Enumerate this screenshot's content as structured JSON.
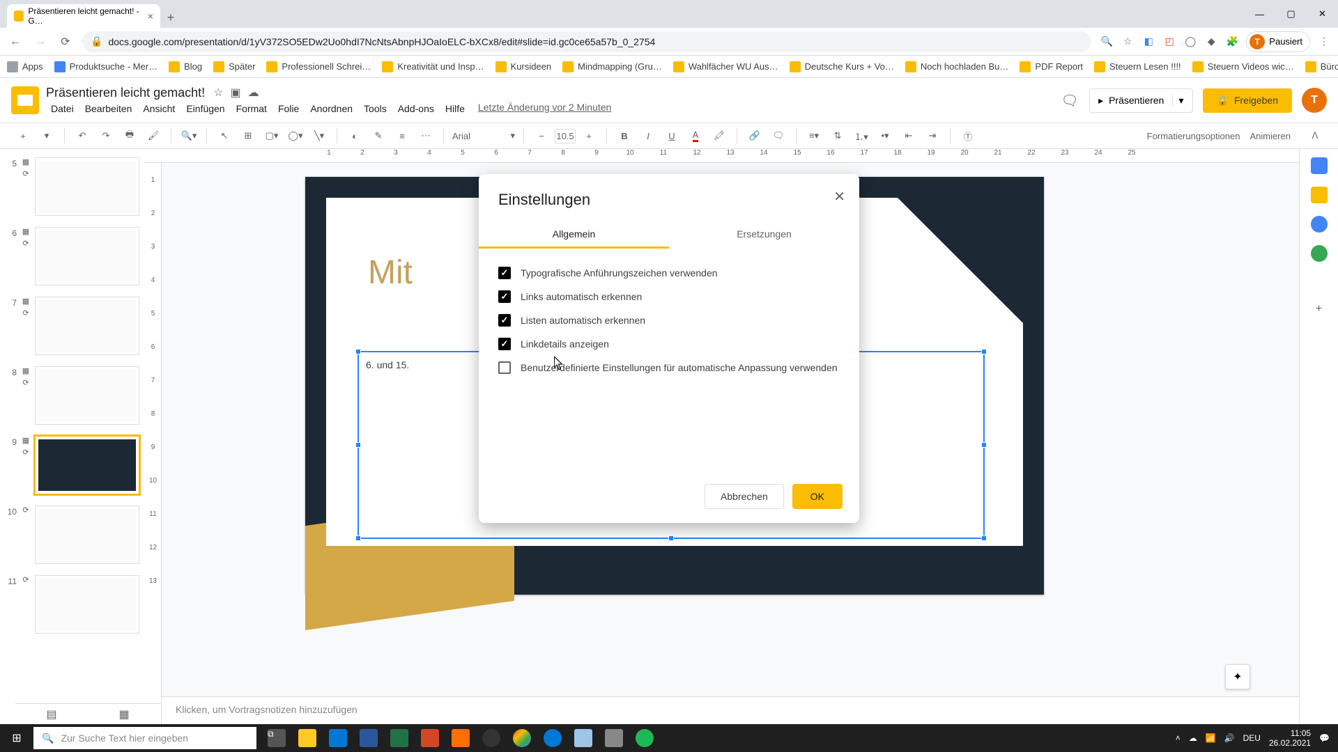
{
  "browser": {
    "tab_title": "Präsentieren leicht gemacht! - G…",
    "url": "docs.google.com/presentation/d/1yV372SO5EDw2Uo0hdI7NcNtsAbnpHJOaIoELC-bXCx8/edit#slide=id.gc0ce65a57b_0_2754",
    "pausiert": "Pausiert",
    "avatar_letter": "T"
  },
  "bookmarks": [
    "Apps",
    "Produktsuche - Mer…",
    "Blog",
    "Später",
    "Professionell Schrei…",
    "Kreativität und Insp…",
    "Kursideen",
    "Mindmapping (Gru…",
    "Wahlfächer WU Aus…",
    "Deutsche Kurs + Vo…",
    "Noch hochladen Bu…",
    "PDF Report",
    "Steuern Lesen !!!!",
    "Steuern Videos wic…",
    "Büro"
  ],
  "app": {
    "doc_title": "Präsentieren leicht gemacht!",
    "menus": [
      "Datei",
      "Bearbeiten",
      "Ansicht",
      "Einfügen",
      "Format",
      "Folie",
      "Anordnen",
      "Tools",
      "Add-ons",
      "Hilfe"
    ],
    "last_edit": "Letzte Änderung vor 2 Minuten",
    "present": "Präsentieren",
    "share": "Freigeben"
  },
  "toolbar": {
    "font": "Arial",
    "size": "10.5",
    "format_options": "Formatierungsoptionen",
    "animate": "Animieren"
  },
  "ruler_h": [
    "1",
    "2",
    "3",
    "4",
    "5",
    "6",
    "7",
    "8",
    "9",
    "10",
    "11",
    "12",
    "13",
    "14",
    "15",
    "16",
    "17",
    "18",
    "19",
    "20",
    "21",
    "22",
    "23",
    "24",
    "25"
  ],
  "ruler_v": [
    "1",
    "2",
    "3",
    "4",
    "5",
    "6",
    "7",
    "8",
    "9",
    "10",
    "11",
    "12",
    "13"
  ],
  "thumbs": [
    {
      "num": "5"
    },
    {
      "num": "6"
    },
    {
      "num": "7"
    },
    {
      "num": "8"
    },
    {
      "num": "9"
    },
    {
      "num": "10"
    },
    {
      "num": "11"
    }
  ],
  "slide": {
    "title_fragment": "Mit",
    "textbox_text": "6. und 15."
  },
  "notes_placeholder": "Klicken, um Vortragsnotizen hinzuzufügen",
  "dialog": {
    "title": "Einstellungen",
    "tab_general": "Allgemein",
    "tab_substitutions": "Ersetzungen",
    "options": [
      {
        "label": "Typografische Anführungszeichen verwenden",
        "checked": true
      },
      {
        "label": "Links automatisch erkennen",
        "checked": true
      },
      {
        "label": "Listen automatisch erkennen",
        "checked": true
      },
      {
        "label": "Linkdetails anzeigen",
        "checked": true
      },
      {
        "label": "Benutzerdefinierte Einstellungen für automatische Anpassung verwenden",
        "checked": false
      }
    ],
    "cancel": "Abbrechen",
    "ok": "OK"
  },
  "taskbar": {
    "search_placeholder": "Zur Suche Text hier eingeben",
    "lang": "DEU",
    "time": "11:05",
    "date": "26.02.2021"
  }
}
